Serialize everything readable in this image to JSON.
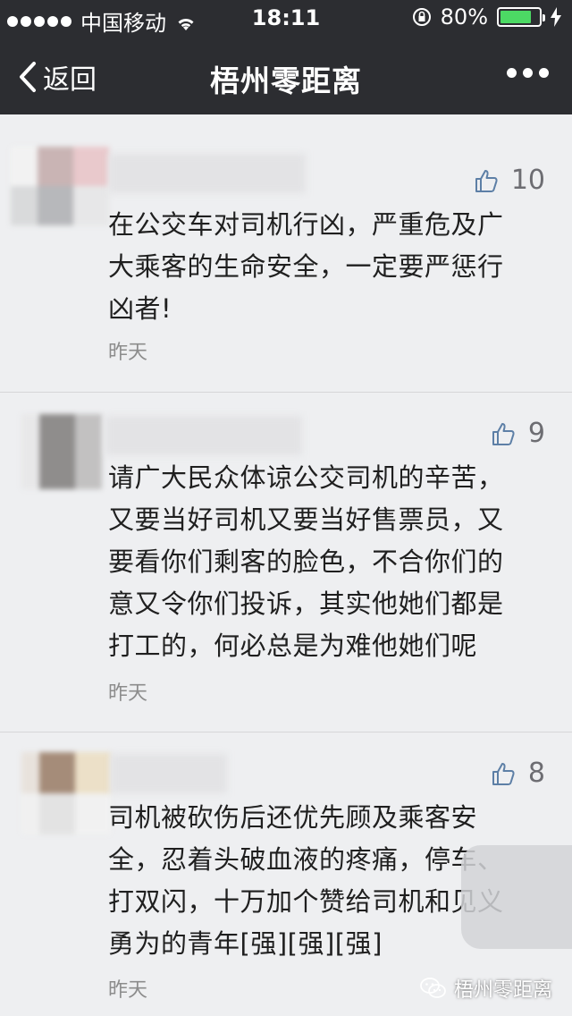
{
  "status_bar": {
    "carrier": "中国移动",
    "time": "18:11",
    "battery": "80%",
    "battery_level": 0.8,
    "icons": [
      "signal-dots-icon",
      "wifi-icon",
      "rotation-lock-icon",
      "battery-icon",
      "charging-icon"
    ]
  },
  "nav": {
    "back_label": "返回",
    "title": "梧州零距离",
    "icons": [
      "chevron-left-icon",
      "more-icon"
    ]
  },
  "comments": [
    {
      "likes": "10",
      "text": [
        "在公交车对司机行凶，严重危及广",
        "大乘客的生命安全，一定要严惩行",
        "凶者!"
      ],
      "time": "昨天"
    },
    {
      "likes": "9",
      "text": [
        "请广大民众体谅公交司机的辛苦，",
        "又要当好司机又要当好售票员，又",
        "要看你们剩客的脸色，不合你们的",
        "意又令你们投诉，其实他她们都是",
        "打工的，何必总是为难他她们呢"
      ],
      "time": "昨天"
    },
    {
      "likes": "8",
      "text": [
        "司机被砍伤后还优先顾及乘客安",
        "全，忍着头破血液的疼痛，停车、",
        "打双闪，十万加个赞给司机和见义",
        "勇为的青年[强][强][强]"
      ],
      "time": "昨天"
    }
  ],
  "watermark": "梧州零距离",
  "colors": {
    "bar_bg": "#2c2d31",
    "page_bg": "#eeeff1",
    "battery_fill": "#4cd964",
    "muted": "#8c8c8c"
  }
}
